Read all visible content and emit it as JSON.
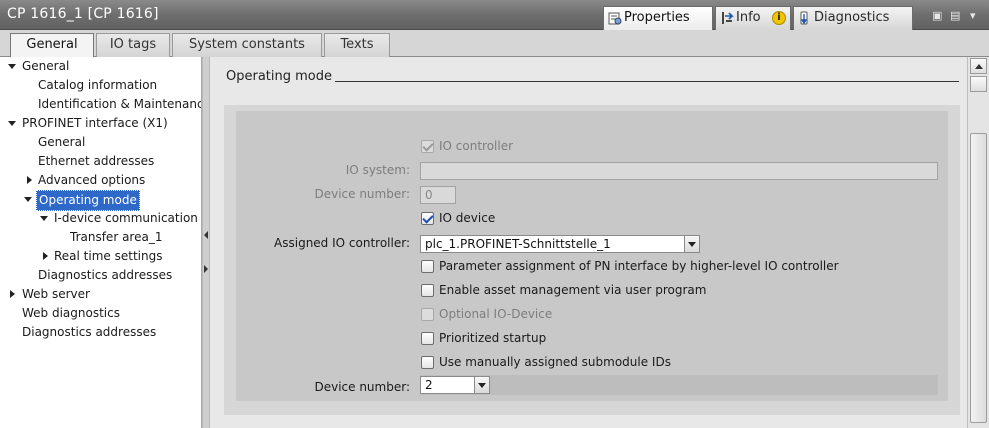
{
  "window": {
    "title": "CP 1616_1 [CP 1616]",
    "inspector_tabs": [
      {
        "label": "Properties",
        "icon": "properties-icon"
      },
      {
        "label": "Info",
        "icon": "info-icon",
        "badge": "i"
      },
      {
        "label": "Diagnostics",
        "icon": "diagnostics-icon"
      }
    ],
    "window_controls": [
      "restore-icon",
      "menu-icon",
      "close-icon"
    ]
  },
  "tabs": [
    "General",
    "IO tags",
    "System constants",
    "Texts"
  ],
  "tree": [
    {
      "label": "General",
      "expander": "expanded"
    },
    {
      "label": "Catalog information"
    },
    {
      "label": "Identification & Maintenance"
    },
    {
      "label": "PROFINET interface (X1)",
      "expander": "expanded"
    },
    {
      "label": "General"
    },
    {
      "label": "Ethernet addresses"
    },
    {
      "label": "Advanced options",
      "expander": "collapsed"
    },
    {
      "label": "Operating mode",
      "expander": "expanded",
      "selected": true
    },
    {
      "label": "I-device communication",
      "expander": "expanded"
    },
    {
      "label": "Transfer area_1"
    },
    {
      "label": "Real time settings",
      "expander": "collapsed"
    },
    {
      "label": "Diagnostics addresses"
    },
    {
      "label": "Web server",
      "expander": "collapsed"
    },
    {
      "label": "Web diagnostics"
    },
    {
      "label": "Diagnostics addresses"
    }
  ],
  "section": {
    "title": "Operating mode",
    "io_controller_label": "IO controller",
    "io_system_label": "IO system:",
    "io_system_value": "",
    "device_number_label": "Device number:",
    "device_number_disabled_value": "0",
    "io_device_label": "IO device",
    "assigned_io_controller_label": "Assigned IO controller:",
    "assigned_io_controller_value": "plc_1.PROFINET-Schnittstelle_1",
    "param_assignment_label": "Parameter assignment of PN interface by higher-level IO controller",
    "asset_management_label": "Enable asset management via user program",
    "optional_io_device_label": "Optional IO-Device",
    "prioritized_startup_label": "Prioritized startup",
    "manual_submodule_ids_label": "Use manually assigned submodule IDs",
    "device_number2_label": "Device number:",
    "device_number2_value": "2"
  },
  "checkboxes": {
    "io_controller": true,
    "io_device": true,
    "param_assignment": false,
    "asset_management": false,
    "optional_io_device": false,
    "prioritized_startup": false,
    "manual_submodule_ids": false
  },
  "colors": {
    "selection": "#2e68c8",
    "titlebar": "#6e6e6e"
  }
}
